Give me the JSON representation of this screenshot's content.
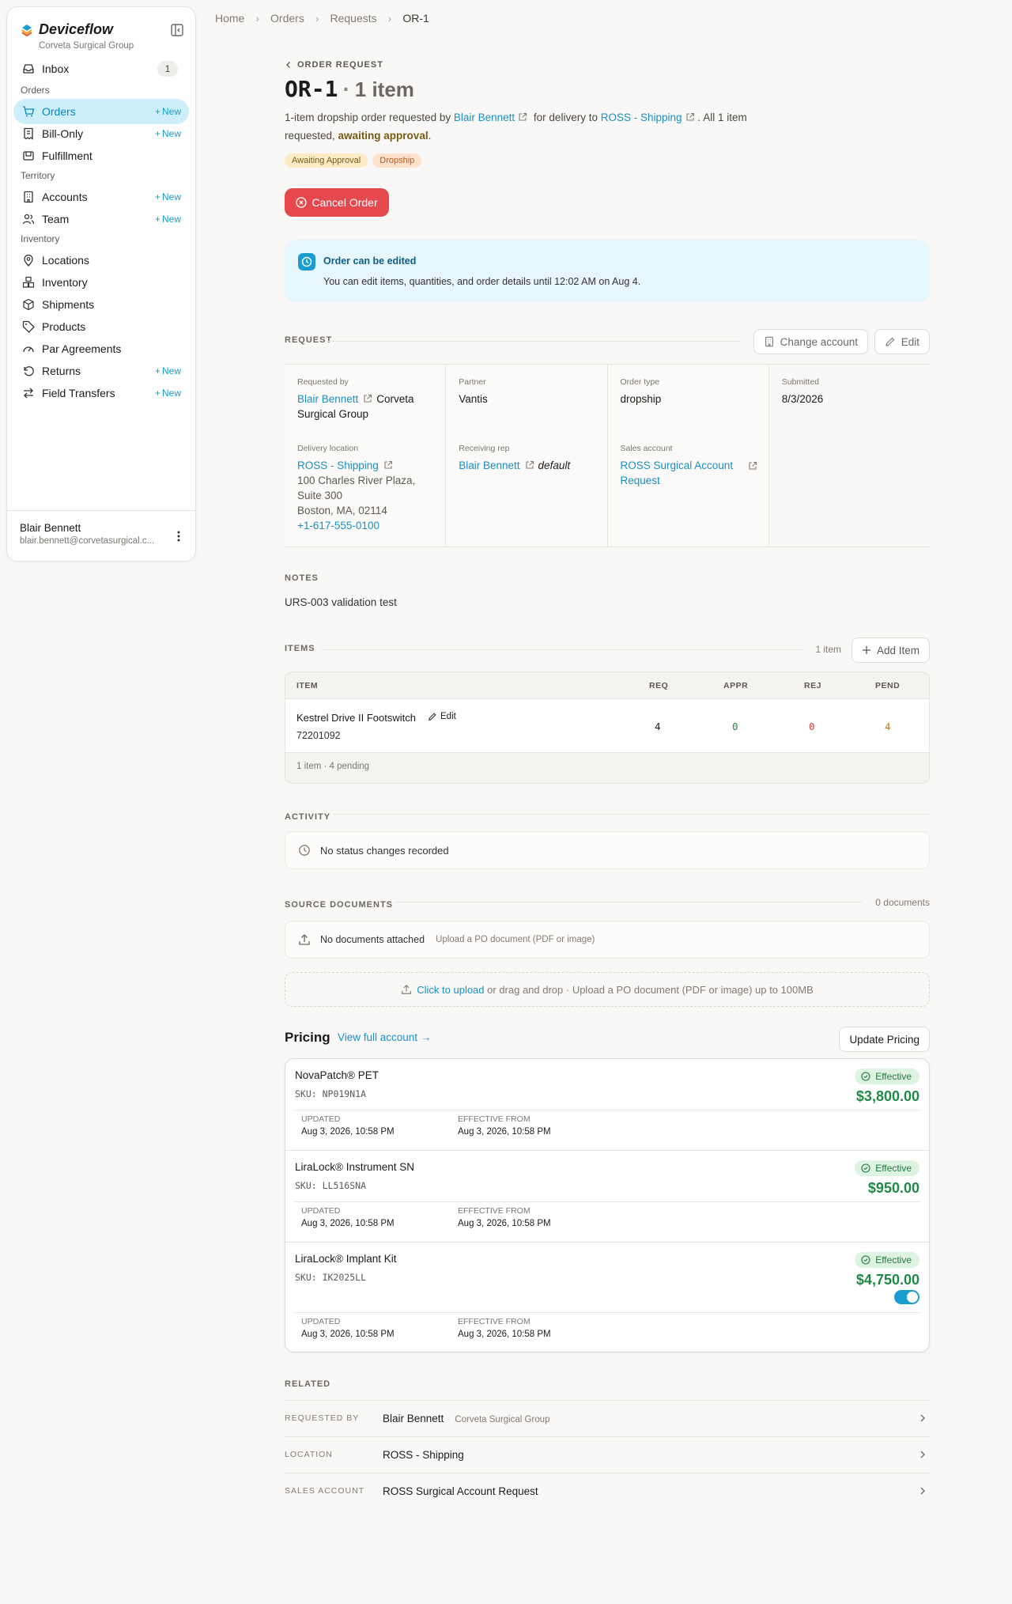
{
  "sidebar": {
    "brand": "Deviceflow",
    "org": "Corveta Surgical Group",
    "inbox": {
      "label": "Inbox",
      "count": "1"
    },
    "sections": {
      "orders": "Orders",
      "territory": "Territory",
      "inventory": "Inventory"
    },
    "new_label": "New",
    "items": {
      "orders": "Orders",
      "bill_only": "Bill-Only",
      "fulfillment": "Fulfillment",
      "accounts": "Accounts",
      "team": "Team",
      "locations": "Locations",
      "inventory": "Inventory",
      "shipments": "Shipments",
      "products": "Products",
      "par_agreements": "Par Agreements",
      "returns": "Returns",
      "field_transfers": "Field Transfers"
    },
    "user": {
      "name": "Blair Bennett",
      "email": "blair.bennett@corvetasurgical.c..."
    }
  },
  "breadcrumb": [
    "Home",
    "Orders",
    "Requests",
    "OR-1"
  ],
  "header": {
    "back_label": "ORDER REQUEST",
    "id": "OR-1",
    "dot": "·",
    "count": "1 item",
    "desc": {
      "p1": "1-item dropship order requested by ",
      "requester": "Blair Bennett",
      "p2": " for delivery to ",
      "location": "ROSS - Shipping",
      "p3": ". All 1 item requested, ",
      "status": "awaiting approval",
      "p4": "."
    },
    "tags": [
      "Awaiting Approval",
      "Dropship"
    ],
    "cancel_label": "Cancel Order"
  },
  "notice": {
    "title": "Order can be edited",
    "text": "You can edit items, quantities, and order details until 12:02 AM on Aug 4."
  },
  "request": {
    "label": "REQUEST",
    "change_account": "Change account",
    "edit": "Edit",
    "requested_by_label": "Requested by",
    "requested_by": "Blair Bennett",
    "requested_by_org": "Corveta Surgical Group",
    "delivery_label": "Delivery location",
    "delivery_name": "ROSS - Shipping",
    "delivery_addr1": "100 Charles River Plaza,",
    "delivery_addr2": "Suite 300",
    "delivery_addr3": "Boston, MA, 02114",
    "delivery_phone": "+1-617-555-0100",
    "partner_label": "Partner",
    "partner": "Vantis",
    "rep_label": "Receiving rep",
    "rep": "Blair Bennett",
    "rep_tag": "default",
    "type_label": "Order type",
    "type": "dropship",
    "sales_label": "Sales account",
    "sales_l1": "ROSS Surgical Account",
    "sales_l2": "Request",
    "submitted_label": "Submitted",
    "submitted": "8/3/2026"
  },
  "notes": {
    "label": "NOTES",
    "text": "URS-003 validation test"
  },
  "items": {
    "label": "ITEMS",
    "count": "1 item",
    "add_label": "Add Item",
    "columns": [
      "ITEM",
      "REQ",
      "APPR",
      "REJ",
      "PEND"
    ],
    "rows": [
      {
        "name": "Kestrel Drive II Footswitch",
        "edit": "Edit",
        "sku": "72201092",
        "req": "4",
        "appr": "0",
        "rej": "0",
        "pend": "4"
      }
    ],
    "footer": "1 item · 4 pending"
  },
  "activity": {
    "label": "ACTIVITY",
    "empty": "No status changes recorded"
  },
  "source_docs": {
    "label": "SOURCE DOCUMENTS",
    "count": "0 documents",
    "empty": "No documents attached",
    "hint": "Upload a PO document (PDF or image)",
    "upload_link": "Click to upload",
    "upload_text": " or drag and drop · Upload a PO document (PDF or image) up to 100MB"
  },
  "pricing": {
    "title": "Pricing",
    "link": "View full account →",
    "update": "Update Pricing",
    "updated_label": "UPDATED",
    "effective_from_label": "EFFECTIVE FROM",
    "items": [
      {
        "name": "NovaPatch® PET",
        "sku": "SKU: NP019N1A",
        "status": "Effective",
        "price": "$3,800.00",
        "updated": "Aug 3, 2026, 10:58 PM",
        "effective_from": "Aug 3, 2026, 10:58 PM"
      },
      {
        "name": "LiraLock® Instrument SN",
        "sku": "SKU: LL516SNA",
        "status": "Effective",
        "price": "$950.00",
        "updated": "Aug 3, 2026, 10:58 PM",
        "effective_from": "Aug 3, 2026, 10:58 PM"
      },
      {
        "name": "LiraLock® Implant Kit",
        "sku": "SKU: IK2025LL",
        "status": "Effective",
        "price": "$4,750.00",
        "updated": "Aug 3, 2026, 10:58 PM",
        "effective_from": "Aug 3, 2026, 10:58 PM",
        "toggle_on": true
      }
    ]
  },
  "related": {
    "label": "RELATED",
    "rows": [
      {
        "key": "REQUESTED BY",
        "value": "Blair Bennett",
        "sub": "Corveta Surgical Group"
      },
      {
        "key": "LOCATION",
        "value": "ROSS - Shipping"
      },
      {
        "key": "SALES ACCOUNT",
        "value": "ROSS Surgical Account Request"
      }
    ]
  },
  "colors": {
    "accent": "#1a9cd0",
    "danger": "#e5484d",
    "success": "#1e8a45",
    "warning": "#7a5a12"
  }
}
